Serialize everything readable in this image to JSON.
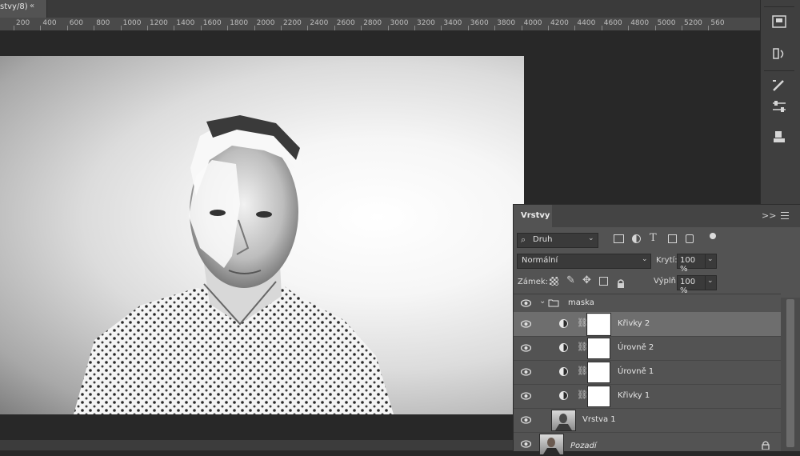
{
  "document": {
    "tab_title": "stvy/8)",
    "tab_close": "«"
  },
  "ruler": {
    "labels": [
      "200",
      "400",
      "600",
      "800",
      "1000",
      "1200",
      "1400",
      "1600",
      "1800",
      "2000",
      "2200",
      "2400",
      "2600",
      "2800",
      "3000",
      "3200",
      "3400",
      "3600",
      "3800",
      "4000",
      "4200",
      "4400",
      "4600",
      "4800",
      "5000",
      "5200",
      "560"
    ]
  },
  "dock": {
    "icons": [
      "libraries-icon",
      "history-icon",
      "brush-presets-icon",
      "adjustments-icon",
      "clone-source-icon"
    ]
  },
  "layers_panel": {
    "tab_label": "Vrstvy",
    "collapse_label": ">>",
    "filter": {
      "kind_label": "Druh",
      "icons": [
        "image-filter-icon",
        "adjustment-filter-icon",
        "type-filter-icon",
        "shape-filter-icon",
        "smart-object-filter-icon",
        "filter-toggle-icon"
      ]
    },
    "blend_mode": "Normální",
    "opacity_label": "Krytí:",
    "opacity_value": "100 %",
    "lock_label": "Zámek:",
    "fill_label": "Výplň:",
    "fill_value": "100 %",
    "layers": [
      {
        "name": "maska",
        "type": "group",
        "selected": false
      },
      {
        "name": "Křivky 2",
        "type": "adjustment",
        "selected": true
      },
      {
        "name": "Úrovně 2",
        "type": "adjustment",
        "selected": false
      },
      {
        "name": "Úrovně 1",
        "type": "adjustment",
        "selected": false
      },
      {
        "name": "Křivky 1",
        "type": "adjustment",
        "selected": false
      },
      {
        "name": "Vrstva 1",
        "type": "pixel",
        "selected": false
      },
      {
        "name": "Pozadí",
        "type": "background",
        "selected": false,
        "locked": true
      }
    ]
  },
  "colors": {
    "workspace": "#282828",
    "panel": "#535353",
    "selected_row": "#6e6e6e"
  }
}
